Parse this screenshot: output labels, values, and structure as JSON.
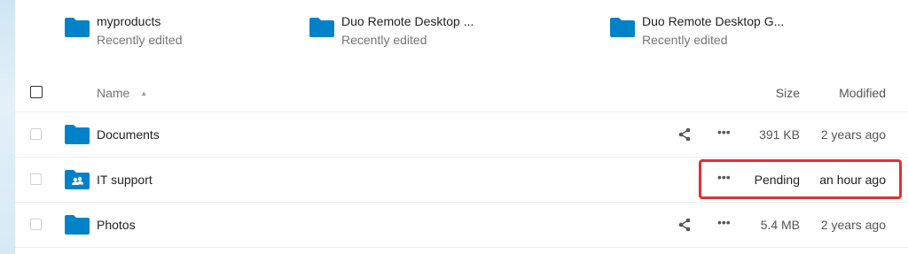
{
  "recent": [
    {
      "name": "myproducts",
      "subtitle": "Recently edited",
      "icon": "folder-icon"
    },
    {
      "name": "Duo Remote Desktop ...",
      "subtitle": "Recently edited",
      "icon": "folder-icon"
    },
    {
      "name": "Duo Remote Desktop G...",
      "subtitle": "Recently edited",
      "icon": "folder-icon"
    }
  ],
  "table": {
    "headers": {
      "name": "Name",
      "size": "Size",
      "modified": "Modified"
    },
    "rows": [
      {
        "name": "Documents",
        "size": "391 KB",
        "modified": "2 years ago",
        "icon": "folder-icon",
        "shared": true
      },
      {
        "name": "IT support",
        "size": "Pending",
        "modified": "an hour ago",
        "icon": "shared-folder-icon",
        "shared": false
      },
      {
        "name": "Photos",
        "size": "5.4 MB",
        "modified": "2 years ago",
        "icon": "folder-icon",
        "shared": true
      }
    ]
  },
  "colors": {
    "accent": "#0082c9",
    "highlight": "#e32f2f"
  }
}
